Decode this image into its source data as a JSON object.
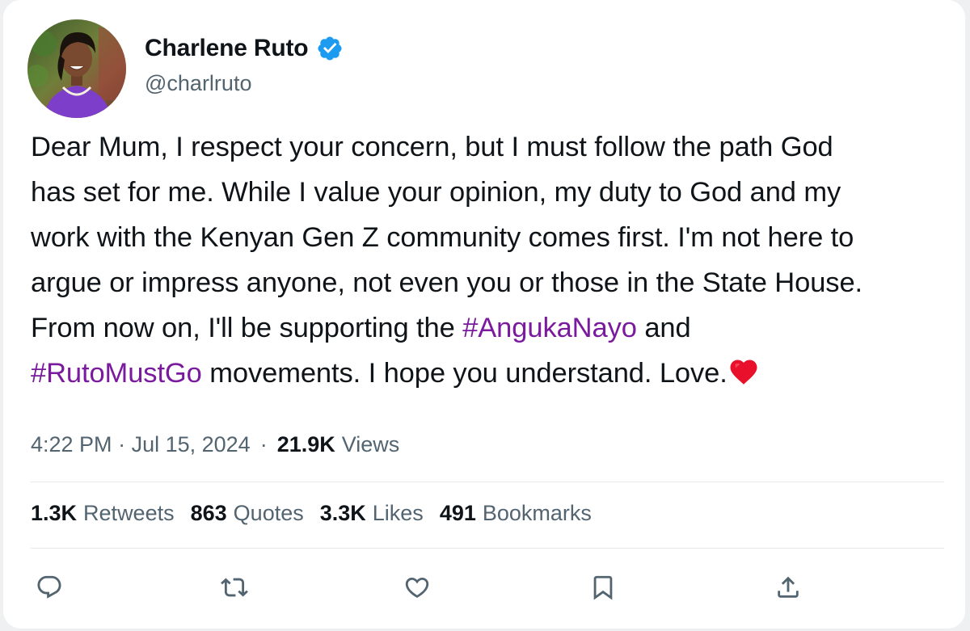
{
  "author": {
    "display_name": "Charlene Ruto",
    "handle": "@charlruto",
    "verified": true,
    "verified_color": "#1d9bf0"
  },
  "tweet": {
    "line1": "Dear Mum, I respect your concern, but I must follow the path God",
    "line2": "has set for me. While I value your opinion, my duty to God and my",
    "line3": "work with the Kenyan Gen Z community comes first. I'm not here to",
    "line4": "argue or impress anyone, not even you or those in the State House.",
    "line5_prefix": "From now on, I'll be supporting the ",
    "hashtag1": "#AngukaNayo",
    "line5_suffix": " and",
    "hashtag2": "#RutoMustGo",
    "line6_suffix": " movements. I hope you understand. Love.",
    "emoji": "red-heart",
    "hashtag_color": "#7a1a9c"
  },
  "meta": {
    "time": "4:22 PM",
    "date_separator": " · ",
    "date": "Jul 15, 2024",
    "separator": "·",
    "views_count": "21.9K",
    "views_label": "Views"
  },
  "stats": {
    "retweets_count": "1.3K",
    "retweets_label": "Retweets",
    "quotes_count": "863",
    "quotes_label": "Quotes",
    "likes_count": "3.3K",
    "likes_label": "Likes",
    "bookmarks_count": "491",
    "bookmarks_label": "Bookmarks"
  },
  "actions": [
    "reply-icon",
    "retweet-icon",
    "like-icon",
    "bookmark-icon",
    "share-icon"
  ]
}
